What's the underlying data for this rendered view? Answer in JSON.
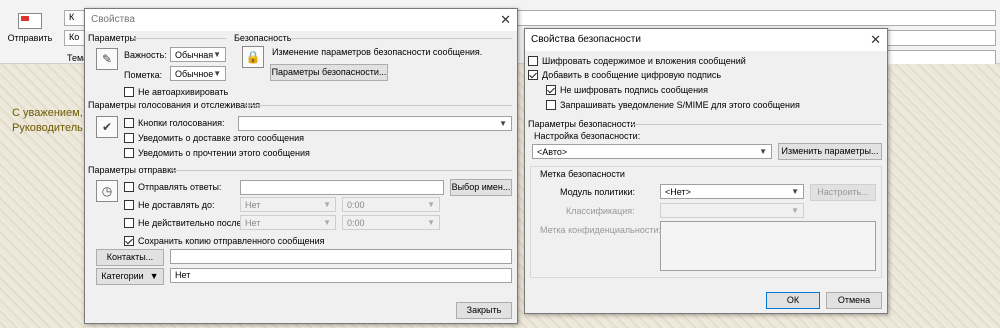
{
  "email": {
    "send_label": "Отправить",
    "to_btn": "К",
    "cc_btn": "Ко",
    "subject_label": "Тема",
    "signature_line1": "С уважением,",
    "signature_line2": "Руководитель с"
  },
  "props_dialog": {
    "title": "Свойства",
    "params_group": "Параметры",
    "importance_label": "Важность:",
    "importance_value": "Обычная",
    "sensitivity_label": "Пометка:",
    "sensitivity_value": "Обычное",
    "no_autoarchive": "Не автоархивировать",
    "security_group": "Безопасность",
    "security_text": "Изменение параметров безопасности сообщения.",
    "security_btn": "Параметры безопасности...",
    "voting_group": "Параметры голосования и отслеживания",
    "voting_buttons": "Кнопки голосования:",
    "notify_delivery": "Уведомить о доставке этого сообщения",
    "notify_read": "Уведомить о прочтении этого сообщения",
    "send_group": "Параметры отправки",
    "reply_to": "Отправлять ответы:",
    "choose_names_btn": "Выбор имен...",
    "do_not_deliver": "Не доставлять до:",
    "expires": "Не действительно после:",
    "date_none": "Нет",
    "time_zero": "0:00",
    "save_copy": "Сохранить копию отправленного сообщения",
    "contacts_btn": "Контакты...",
    "categories_btn": "Категории",
    "categories_value": "Нет",
    "close_btn": "Закрыть"
  },
  "sec_dialog": {
    "title": "Свойства безопасности",
    "encrypt": "Шифровать содержимое и вложения сообщений",
    "add_signature": "Добавить в сообщение цифровую подпись",
    "no_encrypt_signature": "Не шифровать подпись сообщения",
    "request_receipt": "Запрашивать уведомление S/MIME для этого сообщения",
    "sec_params_group": "Параметры безопасности",
    "sec_setting_label": "Настройка безопасности:",
    "sec_setting_value": "<Авто>",
    "change_params_btn": "Изменить параметры...",
    "label_group": "Метка безопасности",
    "policy_label": "Модуль политики:",
    "policy_value": "<Нет>",
    "configure_btn": "Настроить...",
    "classification_label": "Классификация:",
    "privacy_label": "Метка конфиденциальности:",
    "ok_btn": "ОК",
    "cancel_btn": "Отмена"
  },
  "checks": {
    "no_autoarchive": false,
    "voting": false,
    "notify_delivery": false,
    "notify_read": false,
    "reply_to": false,
    "do_not_deliver": false,
    "expires": false,
    "save_copy": true,
    "encrypt": false,
    "add_signature": true,
    "no_encrypt_signature": true,
    "request_receipt": false
  }
}
